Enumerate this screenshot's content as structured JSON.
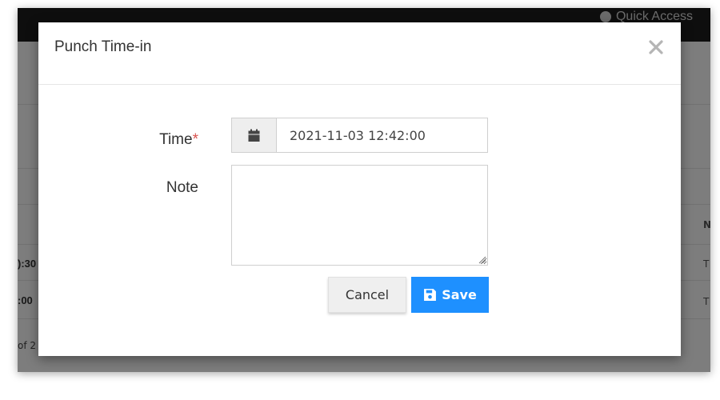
{
  "background": {
    "topbar": {
      "quick_access_label": "Quick Access"
    },
    "rows": [
      {
        "cell": "):30",
        "right": "T"
      },
      {
        "cell": ":00",
        "right": "T"
      }
    ],
    "pager_text": "of 2",
    "sort_char": "N"
  },
  "modal": {
    "title": "Punch Time-in",
    "close_glyph": "×",
    "form": {
      "time_label": "Time",
      "required_mark": "*",
      "time_value": "2021-11-03 12:42:00",
      "note_label": "Note",
      "note_value": ""
    },
    "buttons": {
      "cancel_label": "Cancel",
      "save_label": "Save"
    }
  },
  "colors": {
    "primary": "#1e90ff",
    "required": "#d9534f",
    "overlay": "rgba(0,0,0,0.5)"
  },
  "icons": {
    "calendar": "calendar-icon",
    "save": "floppy-disk-icon",
    "close": "close-icon",
    "quick_access": "compass-icon"
  }
}
